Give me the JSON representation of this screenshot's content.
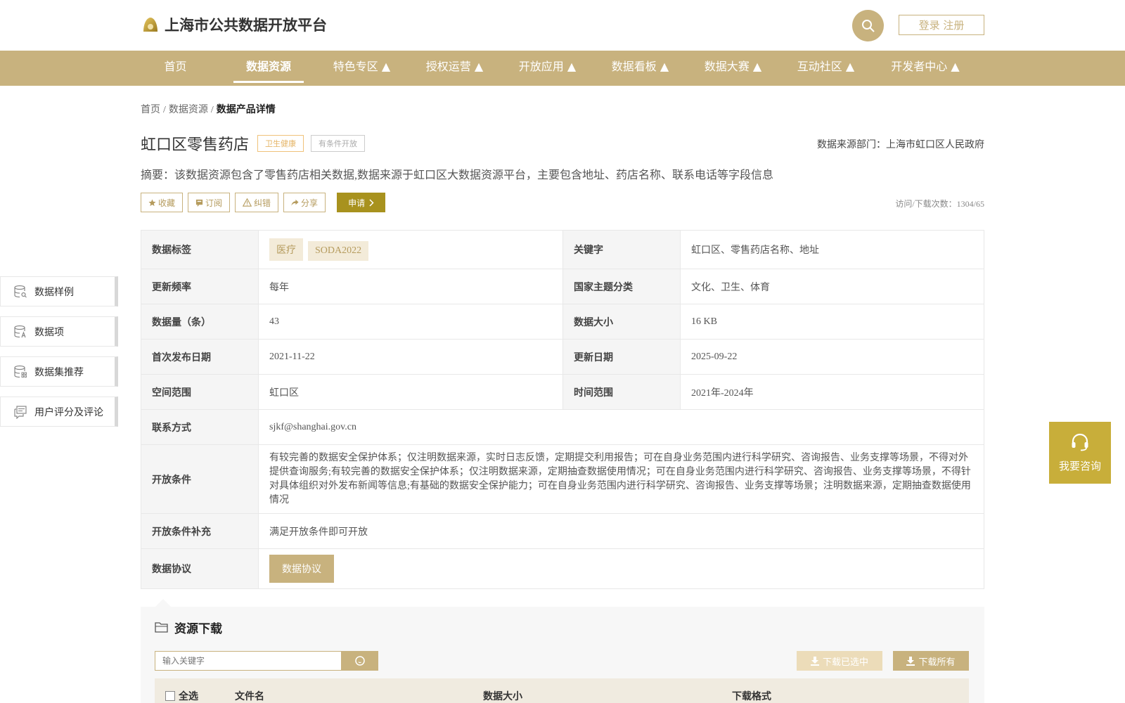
{
  "header": {
    "site_title": "上海市公共数据开放平台",
    "login_label": "登录 注册",
    "brand_color": "#c8b27e"
  },
  "nav": {
    "items": [
      {
        "label": "首页"
      },
      {
        "label": "数据资源",
        "active": true
      },
      {
        "label": "特色专区 ▲"
      },
      {
        "label": "授权运营 ▲"
      },
      {
        "label": "开放应用 ▲"
      },
      {
        "label": "数据看板 ▲"
      },
      {
        "label": "数据大赛 ▲"
      },
      {
        "label": "互动社区 ▲"
      },
      {
        "label": "开发者中心 ▲"
      }
    ]
  },
  "breadcrumb": {
    "home": "首页",
    "sep": "/",
    "section": "数据资源",
    "current": "数据产品详情"
  },
  "dataset": {
    "title": "虹口区零售药店",
    "tag_health": "卫生健康",
    "tag_open": "有条件开放",
    "source_dept": "数据来源部门：上海市虹口区人民政府",
    "summary": "摘要：该数据资源包含了零售药店相关数据,数据来源于虹口区大数据资源平台，主要包含地址、药店名称、联系电话等字段信息",
    "visit_count": "访问/下载次数：1304/65"
  },
  "actions": {
    "favorite": "收藏",
    "subscribe": "订阅",
    "report": "纠错",
    "share": "分享",
    "apply": "申请"
  },
  "table": {
    "tags_label": "数据标签",
    "tags": [
      "医疗",
      "SODA2022"
    ],
    "keywords_label": "关键字",
    "keywords": "虹口区、零售药店名称、地址",
    "freq_label": "更新频率",
    "freq": "每年",
    "theme_label": "国家主题分类",
    "theme": "文化、卫生、体育",
    "count_label": "数据量（条）",
    "count": "43",
    "size_label": "数据大小",
    "size": "16 KB",
    "first_pub_label": "首次发布日期",
    "first_pub": "2021-11-22",
    "updated_label": "更新日期",
    "updated": "2025-09-22",
    "space_label": "空间范围",
    "space": "虹口区",
    "time_label": "时间范围",
    "time": "2021年-2024年",
    "contact_label": "联系方式",
    "contact": "sjkf@shanghai.gov.cn",
    "conditions_label": "开放条件",
    "conditions": "有较完善的数据安全保护体系；仅注明数据来源，实时日志反馈，定期提交利用报告；可在自身业务范围内进行科学研究、咨询报告、业务支撑等场景，不得对外提供查询服务;有较完善的数据安全保护体系；仅注明数据来源，定期抽查数据使用情况；可在自身业务范围内进行科学研究、咨询报告、业务支撑等场景，不得针对具体组织对外发布新闻等信息;有基础的数据安全保护能力；可在自身业务范围内进行科学研究、咨询报告、业务支撑等场景；注明数据来源，定期抽查数据使用情况",
    "cond_extra_label": "开放条件补充",
    "cond_extra": "满足开放条件即可开放",
    "agreement_label": "数据协议",
    "agreement_btn": "数据协议"
  },
  "side_nav": {
    "items": [
      {
        "label": "数据样例",
        "icon": "database-search-icon"
      },
      {
        "label": "数据项",
        "icon": "database-text-icon"
      },
      {
        "label": "数据集推荐",
        "icon": "database-grid-icon"
      },
      {
        "label": "用户评分及评论",
        "icon": "comment-icon"
      }
    ]
  },
  "consult": {
    "label": "我要咨询"
  },
  "resources": {
    "title": "资源下载",
    "search_placeholder": "输入关键字",
    "download_selected": "下载已选中",
    "download_all": "下载所有",
    "col_select_all": "全选",
    "col_filename": "文件名",
    "col_size": "数据大小",
    "col_format": "下载格式"
  }
}
